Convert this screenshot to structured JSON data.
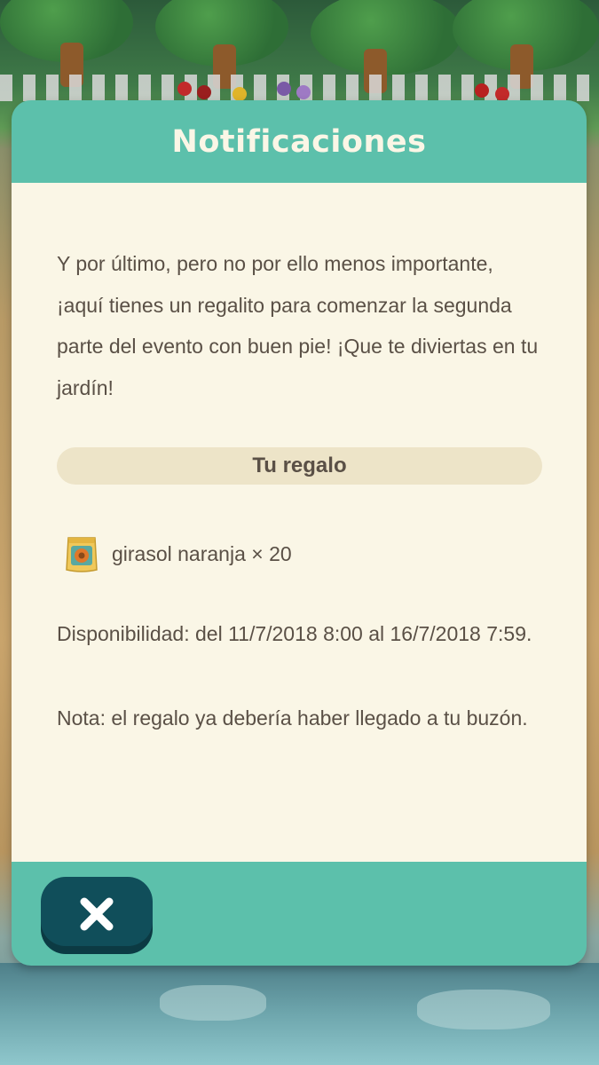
{
  "dialog": {
    "title": "Notificaciones",
    "message": "Y por último, pero no por ello menos importante, ¡aquí tienes un regalito para comenzar la segunda parte del evento con buen pie! ¡Que te diviertas en tu jardín!",
    "gift_header": "Tu regalo",
    "gift_item": {
      "icon": "seed-bag-icon",
      "label": "girasol naranja × 20"
    },
    "availability": "Disponibilidad: del 11/7/2018 8:00 al 16/7/2018 7:59.",
    "note": "Nota: el regalo ya debería haber llegado a tu buzón.",
    "close_icon": "close-icon"
  },
  "colors": {
    "header_teal": "#5cc0ab",
    "body_cream": "#faf6e6",
    "gift_bar": "#ede4c8",
    "text_brown": "#5a5046",
    "close_button": "#104e5a"
  }
}
